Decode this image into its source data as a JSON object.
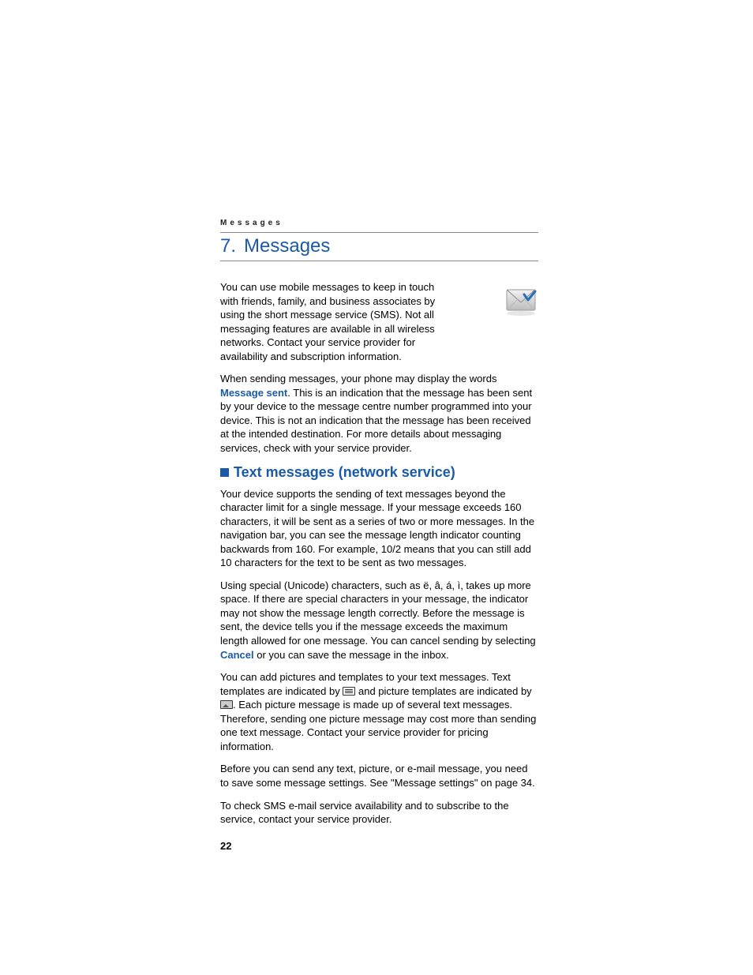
{
  "running_head": "Messages",
  "chapter": {
    "number": "7.",
    "title": "Messages"
  },
  "intro": "You can use mobile messages to keep in touch with friends, family, and business associates by using the short message service (SMS). Not all messaging features are available in all wireless networks. Contact your service provider for availability and subscription information.",
  "sent_para": {
    "p1": "When sending messages, your phone may display the words ",
    "term": "Message sent",
    "p2": ". This is an indication that the message has been sent by your device to the message centre number programmed into your device. This is not an indication that the message has been received at the intended destination. For more details about messaging services, check with your service provider."
  },
  "section_heading": "Text messages (network service)",
  "body1": "Your device supports the sending of text messages beyond the character limit for a single message. If your message exceeds 160 characters, it will be sent as a series of two or more messages. In the navigation bar, you can see the message length indicator counting backwards from 160. For example, 10/2 means that you can still add 10 characters for the text to be sent as two messages.",
  "body2": {
    "p1": "Using special (Unicode) characters, such as ë, â, á, ì, takes up more space. If there are special characters in your message, the indicator may not show the message length correctly. Before the message is sent, the device tells you if the message exceeds the maximum length allowed for one message. You can cancel sending by selecting ",
    "term": "Cancel",
    "p2": " or you can save the message in the inbox."
  },
  "body3": {
    "p1": "You can add pictures and templates to your text messages. Text templates are indicated by ",
    "p2": " and picture templates are indicated by ",
    "p3": ". Each picture message is made up of several text messages. Therefore, sending one picture message may cost more than sending one text message. Contact your service provider for pricing information."
  },
  "body4": "Before you can send any text, picture, or e-mail message, you need to save some message settings. See \"Message settings\" on page 34.",
  "body5": "To check SMS e-mail service availability and to subscribe to the service, contact your service provider.",
  "page_number": "22",
  "icons": {
    "envelope": "envelope-icon",
    "text_template": "text-template-icon",
    "picture_template": "picture-template-icon"
  }
}
